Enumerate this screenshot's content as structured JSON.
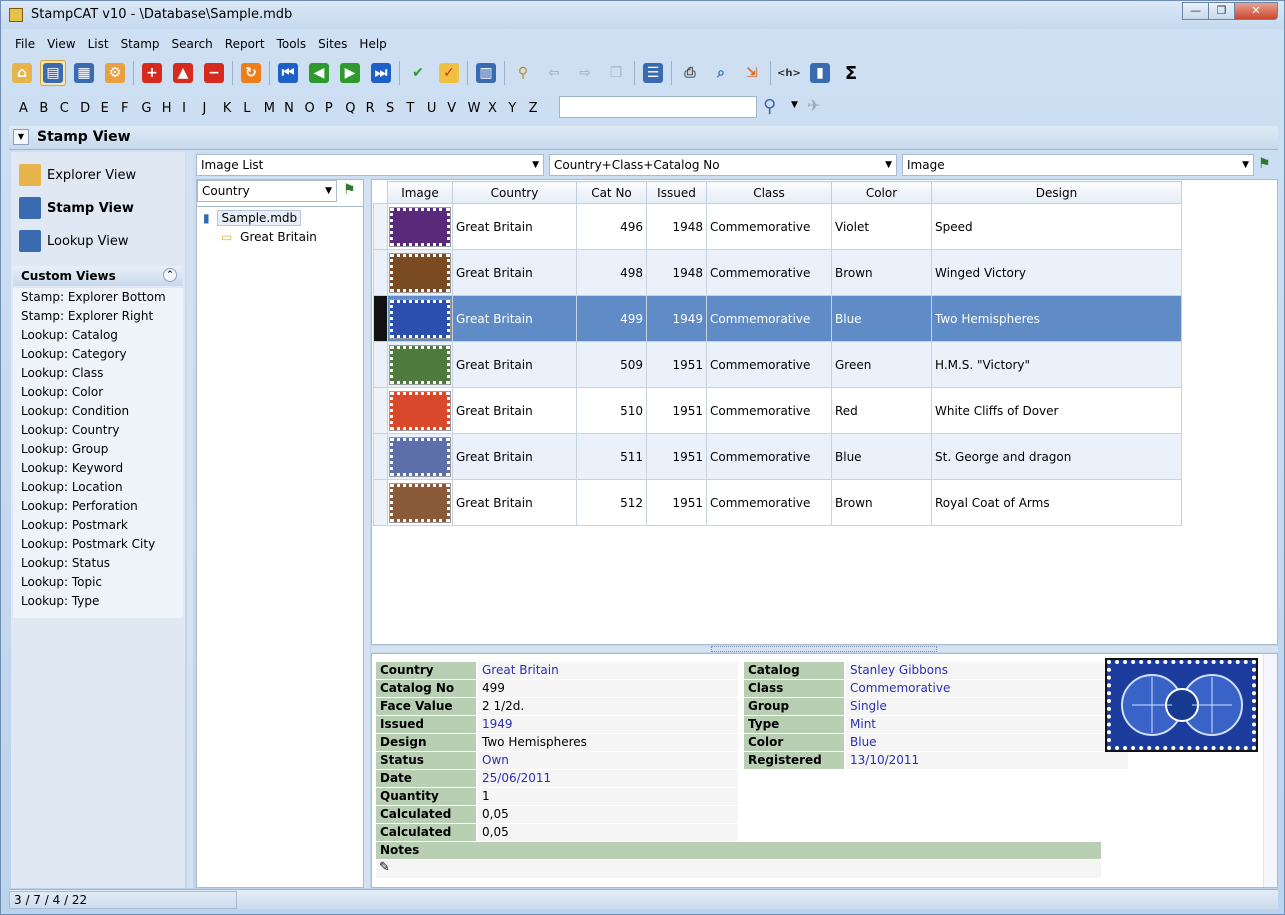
{
  "window": {
    "title": "StampCAT v10 - \\Database\\Sample.mdb",
    "min": "—",
    "max": "❐",
    "close": "✕"
  },
  "menu": [
    "File",
    "View",
    "List",
    "Stamp",
    "Search",
    "Report",
    "Tools",
    "Sites",
    "Help"
  ],
  "alphabet": [
    "A",
    "B",
    "C",
    "D",
    "E",
    "F",
    "G",
    "H",
    "I",
    "J",
    "K",
    "L",
    "M",
    "N",
    "O",
    "P",
    "Q",
    "R",
    "S",
    "T",
    "U",
    "V",
    "W",
    "X",
    "Y",
    "Z"
  ],
  "search": {
    "value": "",
    "placeholder": ""
  },
  "view_header": {
    "title": "Stamp View"
  },
  "nav": [
    {
      "label": "Explorer View",
      "bold": false,
      "icon": "explorer-view-icon"
    },
    {
      "label": "Stamp View",
      "bold": true,
      "icon": "stamp-view-icon"
    },
    {
      "label": "Lookup View",
      "bold": false,
      "icon": "lookup-view-icon"
    }
  ],
  "custom_views": {
    "title": "Custom Views",
    "items": [
      "Stamp: Explorer Bottom",
      "Stamp: Explorer Right",
      "Lookup: Catalog",
      "Lookup: Category",
      "Lookup: Class",
      "Lookup: Color",
      "Lookup: Condition",
      "Lookup: Country",
      "Lookup: Group",
      "Lookup: Keyword",
      "Lookup: Location",
      "Lookup: Perforation",
      "Lookup: Postmark",
      "Lookup: Postmark City",
      "Lookup: Status",
      "Lookup: Topic",
      "Lookup: Type"
    ]
  },
  "combos": {
    "list_type": "Image List",
    "sort": "Country+Class+Catalog No",
    "image": "Image",
    "tree_group": "Country"
  },
  "tree": {
    "root": "Sample.mdb",
    "child": "Great Britain"
  },
  "grid": {
    "columns": [
      "Image",
      "Country",
      "Cat No",
      "Issued",
      "Class",
      "Color",
      "Design"
    ],
    "rows": [
      {
        "country": "Great Britain",
        "cat_no": "496",
        "issued": "1948",
        "class": "Commemorative",
        "color": "Violet",
        "design": "Speed",
        "stamp_color": "#5a2a7a"
      },
      {
        "country": "Great Britain",
        "cat_no": "498",
        "issued": "1948",
        "class": "Commemorative",
        "color": "Brown",
        "design": "Winged Victory",
        "stamp_color": "#7a4a22"
      },
      {
        "country": "Great Britain",
        "cat_no": "499",
        "issued": "1949",
        "class": "Commemorative",
        "color": "Blue",
        "design": "Two Hemispheres",
        "stamp_color": "#2a4fae"
      },
      {
        "country": "Great Britain",
        "cat_no": "509",
        "issued": "1951",
        "class": "Commemorative",
        "color": "Green",
        "design": "H.M.S. \"Victory\"",
        "stamp_color": "#4f7a3e"
      },
      {
        "country": "Great Britain",
        "cat_no": "510",
        "issued": "1951",
        "class": "Commemorative",
        "color": "Red",
        "design": "White Cliffs of Dover",
        "stamp_color": "#d9482a"
      },
      {
        "country": "Great Britain",
        "cat_no": "511",
        "issued": "1951",
        "class": "Commemorative",
        "color": "Blue",
        "design": "St. George and dragon",
        "stamp_color": "#5c6fa8"
      },
      {
        "country": "Great Britain",
        "cat_no": "512",
        "issued": "1951",
        "class": "Commemorative",
        "color": "Brown",
        "design": "Royal Coat of Arms",
        "stamp_color": "#8a5a38"
      }
    ]
  },
  "details": {
    "left": [
      {
        "label": "Country",
        "value": "Great Britain",
        "link": true
      },
      {
        "label": "Catalog No",
        "value": "499",
        "link": false
      },
      {
        "label": "Face Value",
        "value": "2 1/2d.",
        "link": false
      },
      {
        "label": "Issued",
        "value": "1949",
        "link": true
      },
      {
        "label": "Design",
        "value": "Two Hemispheres",
        "link": false
      },
      {
        "label": "Status",
        "value": "Own",
        "link": true
      },
      {
        "label": "Date Acquired",
        "value": "25/06/2011",
        "link": true
      },
      {
        "label": "Quantity",
        "value": "1",
        "link": false
      },
      {
        "label": "Calculated Price",
        "value": "0,05",
        "link": false
      },
      {
        "label": "Calculated Value",
        "value": "0,05",
        "link": false
      }
    ],
    "right": [
      {
        "label": "Catalog",
        "value": "Stanley Gibbons",
        "link": true
      },
      {
        "label": "Class",
        "value": "Commemorative",
        "link": true
      },
      {
        "label": "Group",
        "value": "Single",
        "link": true
      },
      {
        "label": "Type",
        "value": "Mint",
        "link": true
      },
      {
        "label": "Color",
        "value": "Blue",
        "link": true
      },
      {
        "label": "Registered",
        "value": "13/10/2011",
        "link": true
      }
    ],
    "notes_label": "Notes"
  },
  "status": {
    "text": "3 / 7 / 4 / 22"
  },
  "colors": {
    "selected_row": "#5f8bc7",
    "alt_row": "#eaf1fb",
    "label_bg": "#b9cfb4",
    "link": "#2b2fb4"
  }
}
